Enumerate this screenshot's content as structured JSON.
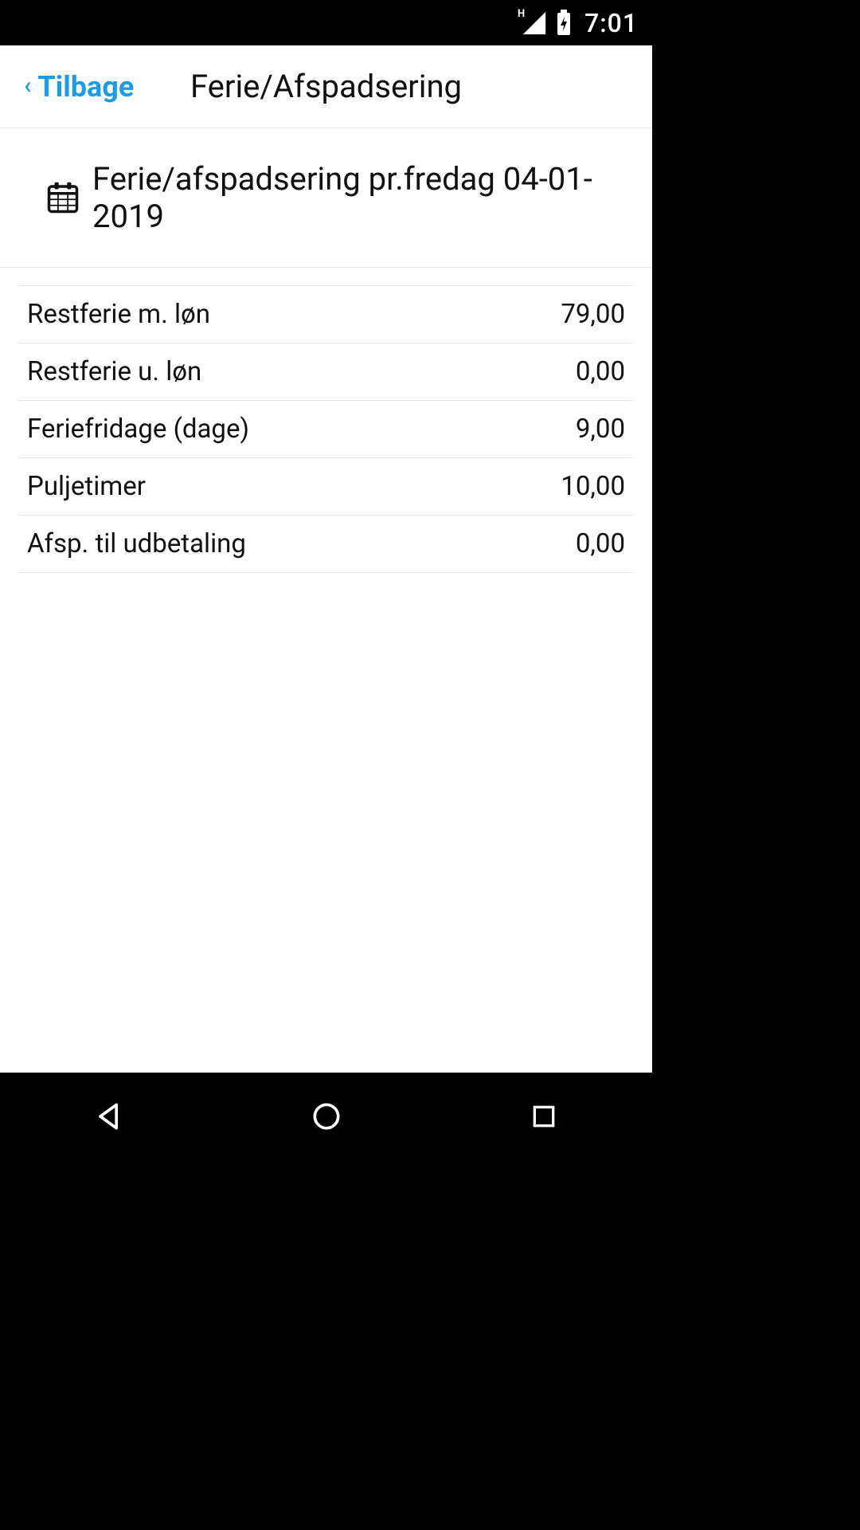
{
  "status_bar": {
    "clock": "7:01",
    "network_type": "H"
  },
  "header": {
    "back_label": "Tilbage",
    "title": "Ferie/Afspadsering"
  },
  "section": {
    "heading": "Ferie/afspadsering pr.fredag 04-01-2019"
  },
  "rows": [
    {
      "label": "Restferie m. løn",
      "value": "79,00"
    },
    {
      "label": "Restferie u. løn",
      "value": "0,00"
    },
    {
      "label": "Feriefridage (dage)",
      "value": "9,00"
    },
    {
      "label": "Puljetimer",
      "value": "10,00"
    },
    {
      "label": "Afsp. til udbetaling",
      "value": "0,00"
    }
  ]
}
